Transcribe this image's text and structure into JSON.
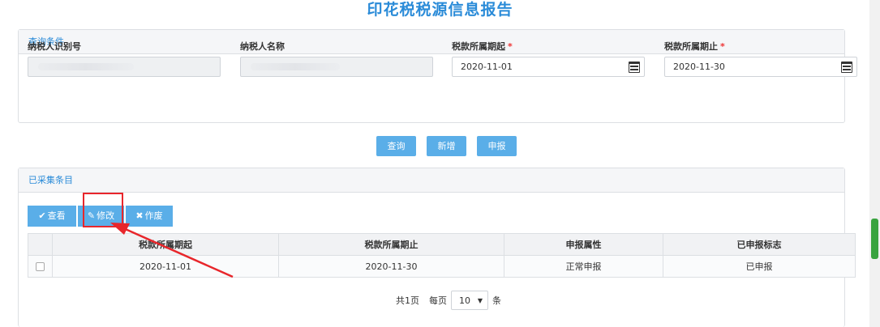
{
  "page": {
    "title": "印花税税源信息报告"
  },
  "query_panel": {
    "heading": "查询条件",
    "fields": {
      "taxpayer_id": {
        "label": "纳税人识别号",
        "value": ""
      },
      "taxpayer_name": {
        "label": "纳税人名称",
        "value": ""
      },
      "period_start": {
        "label": "税款所属期起",
        "required_mark": "*",
        "value": "2020-11-01"
      },
      "period_end": {
        "label": "税款所属期止",
        "required_mark": "*",
        "value": "2020-11-30"
      }
    }
  },
  "actions": {
    "query": "查询",
    "add": "新增",
    "declare": "申报"
  },
  "list_panel": {
    "heading": "已采集条目",
    "toolbar": {
      "view": {
        "icon": "✔",
        "label": "查看"
      },
      "edit": {
        "icon": "✎",
        "label": "修改"
      },
      "void": {
        "icon": "✖",
        "label": "作废"
      }
    },
    "columns": [
      "税款所属期起",
      "税款所属期止",
      "申报属性",
      "已申报标志"
    ],
    "rows": [
      {
        "start": "2020-11-01",
        "end": "2020-11-30",
        "attr": "正常申报",
        "flag": "已申报"
      }
    ]
  },
  "pager": {
    "total": "共1页",
    "per_page": "每页",
    "page_size": "10",
    "unit": "条"
  },
  "colors": {
    "primary": "#5aaee8",
    "title": "#2a8bd8",
    "annotation": "#e8262b",
    "scrollbar": "#39a33f"
  }
}
